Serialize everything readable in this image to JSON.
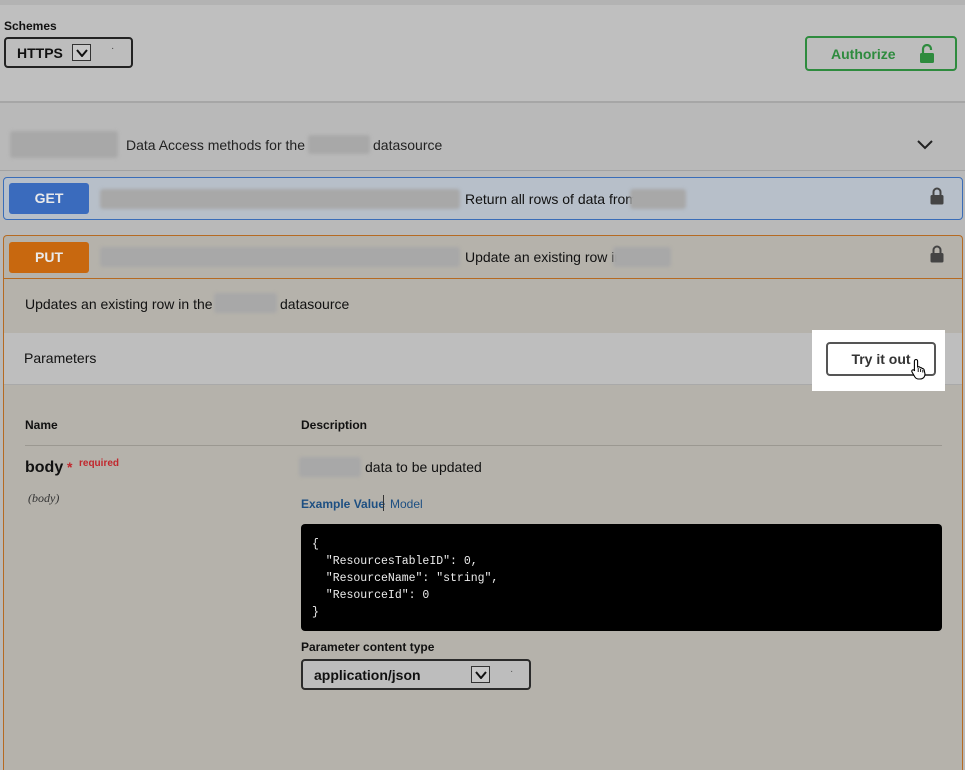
{
  "header": {
    "schemes_label": "Schemes",
    "scheme_value": "HTTPS",
    "authorize_label": "Authorize"
  },
  "tag": {
    "description_prefix": "Data Access methods for the",
    "description_suffix": "datasource"
  },
  "operations": [
    {
      "method": "GET",
      "summary": "Return all rows of data from",
      "color": "#3a6bbd"
    },
    {
      "method": "PUT",
      "summary": "Update an existing row in",
      "color": "#c8680f",
      "description_prefix": "Updates an existing row in the",
      "description_suffix": "datasource",
      "parameters_title": "Parameters",
      "try_it_out_label": "Try it out",
      "columns": {
        "name": "Name",
        "description": "Description"
      },
      "param": {
        "name": "body",
        "required_star": "*",
        "required_label": "required",
        "location": "(body)",
        "description": "data to be updated"
      },
      "tabs": {
        "example": "Example Value",
        "model": "Model"
      },
      "example_json": "{\n  \"ResourcesTableID\": 0,\n  \"ResourceName\": \"string\",\n  \"ResourceId\": 0\n}",
      "content_type_label": "Parameter content type",
      "content_type_value": "application/json"
    }
  ],
  "colors": {
    "authorize": "#2e8b3e",
    "required": "#c1272d",
    "link": "#1d4f82"
  }
}
